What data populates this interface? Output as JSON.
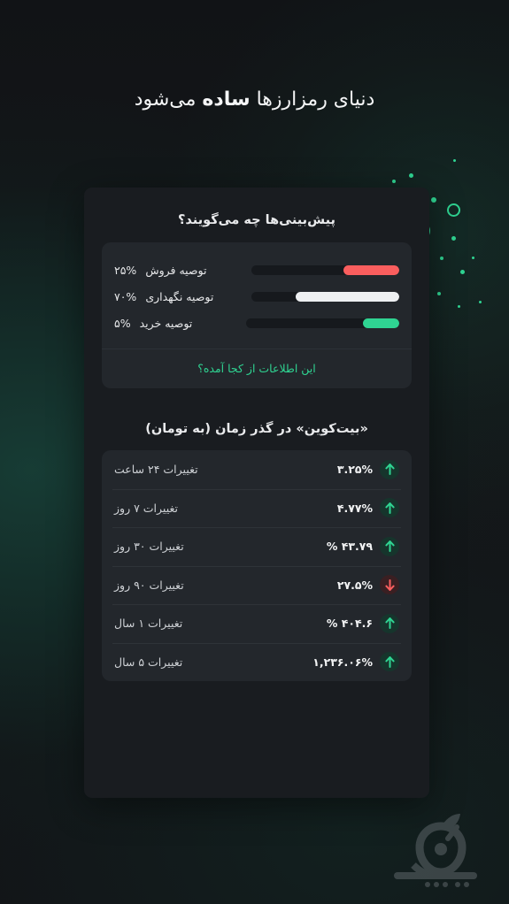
{
  "page": {
    "headline_normal_1": "دنیای رمزارزها ",
    "headline_bold": "ساده",
    "headline_normal_2": " می‌شود"
  },
  "predictions": {
    "title": "پیش‌بینی‌ها چه می‌گویند؟",
    "rows": [
      {
        "label": "توصیه فروش",
        "percent": "۲۵%",
        "value": 25,
        "color": "#fa5e5e",
        "icon": "sell-bar"
      },
      {
        "label": "توصیه نگهداری",
        "percent": "۷۰%",
        "value": 70,
        "color": "#eef0f2",
        "icon": "hold-bar"
      },
      {
        "label": "توصیه خرید",
        "percent": "۵%",
        "value": 5,
        "color": "#2fd492",
        "icon": "buy-bar"
      }
    ],
    "source_link": "این اطلاعات از کجا آمده؟"
  },
  "history": {
    "title": "«بیت‌کوین» در گذر زمان (به تومان)",
    "rows": [
      {
        "name": "تغییرات ۲۴ ساعت",
        "value": "۳.۲۵%",
        "direction": "up",
        "icon": "arrow-up-icon"
      },
      {
        "name": "تغییرات ۷ روز",
        "value": "۴.۷۷%",
        "direction": "up",
        "icon": "arrow-up-icon"
      },
      {
        "name": "تغییرات ۳۰ روز",
        "value": "۴۳.۷۹ %",
        "direction": "up",
        "icon": "arrow-up-icon"
      },
      {
        "name": "تغییرات ۹۰ روز",
        "value": "۲۷.۵%",
        "direction": "down",
        "icon": "arrow-down-icon"
      },
      {
        "name": "تغییرات ۱ سال",
        "value": "۴۰۴.۶ %",
        "direction": "up",
        "icon": "arrow-up-icon"
      },
      {
        "name": "تغییرات ۵ سال",
        "value": "۱,۲۳۶.۰۶%",
        "direction": "up",
        "icon": "arrow-up-icon"
      }
    ]
  },
  "colors": {
    "accent_green": "#2fd492",
    "negative_red": "#fa5e5e",
    "neutral_white": "#eef0f2",
    "card_bg": "#191c20",
    "panel_bg": "#23272c"
  },
  "watermark": {
    "name": "sibche-logo"
  }
}
